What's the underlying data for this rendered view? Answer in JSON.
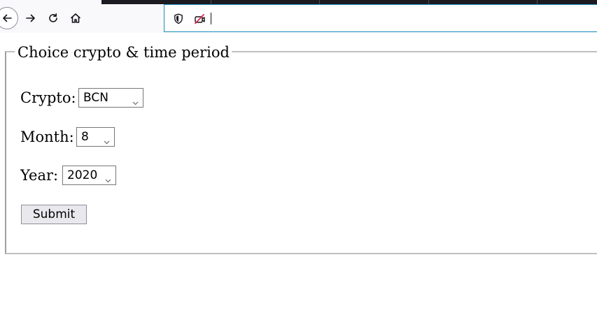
{
  "browser": {
    "url_value": "",
    "icons": [
      "back-arrow-icon",
      "forward-arrow-icon",
      "reload-icon",
      "home-icon",
      "shield-icon",
      "permissions-blocked-icon"
    ]
  },
  "form": {
    "legend": "Choice crypto & time period",
    "crypto_label": "Crypto:",
    "crypto_value": "BCN",
    "month_label": "Month:",
    "month_value": "8",
    "year_label": "Year:",
    "year_value": "2020",
    "submit_label": "Submit"
  },
  "colors": {
    "url_focus_border": "#1a8cbf",
    "tabstrip": "#1c1b22",
    "button_bg": "#e9e9ed",
    "blocked_icon": "#e22850"
  }
}
